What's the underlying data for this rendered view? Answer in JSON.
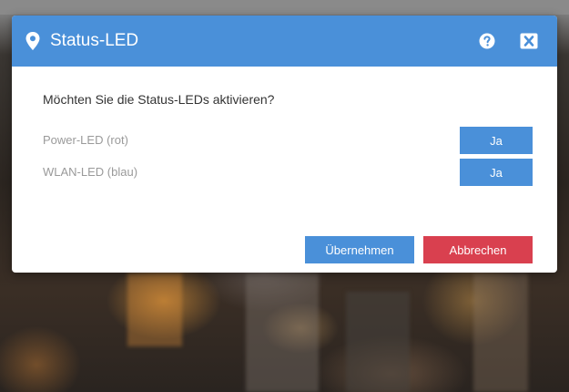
{
  "dialog": {
    "title": "Status-LED",
    "icons": {
      "title": "map-pin-icon",
      "help": "help-icon",
      "close": "close-icon"
    },
    "question": "Möchten Sie die Status-LEDs aktivieren?",
    "rows": [
      {
        "label": "Power-LED (rot)",
        "button": "Ja"
      },
      {
        "label": "WLAN-LED (blau)",
        "button": "Ja"
      }
    ],
    "footer": {
      "apply_label": "Übernehmen",
      "cancel_label": "Abbrechen"
    }
  },
  "colors": {
    "accent": "#4a90d9",
    "danger": "#d9404f",
    "label_gray": "#9a9a9a"
  }
}
